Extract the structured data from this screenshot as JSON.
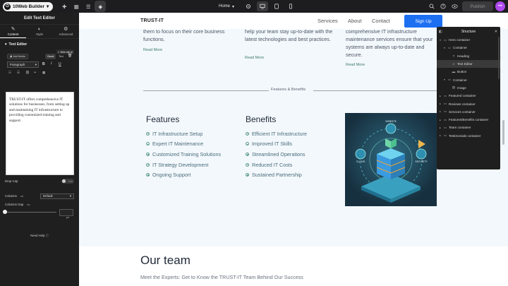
{
  "topbar": {
    "brand": "10Web Builder",
    "page_select": "Home",
    "publish": "Publish",
    "more": "•••"
  },
  "left_panel": {
    "title": "Edit Text Editor",
    "tabs": [
      {
        "label": "Content",
        "icon": "pencil-icon"
      },
      {
        "label": "Style",
        "icon": "half-circle-icon"
      },
      {
        "label": "Advanced",
        "icon": "gear-icon"
      }
    ],
    "section": "Text Editor",
    "add_media": "Add Media",
    "write_ai": "Write with AI",
    "mode_visual": "Visual",
    "mode_text": "Text",
    "paragraph": "Paragraph",
    "editor_text": "TRUST-IT offers comprehensive IT solutions for businesses, from setting up and maintaining IT infrastructure to providing customized training and support.",
    "drop_cap": "Drop Cap",
    "toggle_off": "OFF",
    "columns": "Columns",
    "columns_value": "Default",
    "columns_gap": "Columns Gap",
    "gap_unit": "px",
    "need_help": "Need Help"
  },
  "site": {
    "logo": "TRUST-IT",
    "nav": [
      "Services",
      "About",
      "Contact"
    ],
    "signup": "Sign Up",
    "columns_top": [
      {
        "text": "them to focus on their core business functions.",
        "read_more": "Read More"
      },
      {
        "text": "help your team stay up-to-date with the latest technologies and best practices.",
        "read_more": "Read More"
      },
      {
        "text": "comprehensive IT infrastructure maintenance services ensure that your systems are always up-to-date and secure.",
        "read_more": "Read More"
      }
    ],
    "divider_label": "Features & Benefits",
    "features_title": "Features",
    "features": [
      "IT Infrastructure Setup",
      "Expert IT Maintenance",
      "Customized Training Solutions",
      "IT Strategy Development",
      "Ongoing Support"
    ],
    "benefits_title": "Benefits",
    "benefits": [
      "Efficient IT Infrastructure",
      "Improved IT Skills",
      "Streamlined Operations",
      "Reduced IT Costs",
      "Sustained Partnership"
    ],
    "illustration_labels": [
      "WEBSITE",
      "CLOUD",
      "SECURITY"
    ],
    "team_title": "Our team",
    "team_subtitle": "Meet the Experts: Get to Know the TRUST-IT Team Behind Our Success"
  },
  "structure": {
    "title": "Structure",
    "rows": [
      {
        "label": "Hero container",
        "caret": "▾",
        "icon": "container-icon",
        "depth": 0,
        "selected": false
      },
      {
        "label": "Container",
        "caret": "▾",
        "icon": "container-icon",
        "depth": 1,
        "selected": false
      },
      {
        "label": "Heading",
        "caret": "",
        "icon": "heading-icon",
        "depth": 2,
        "selected": false
      },
      {
        "label": "Text Editor",
        "caret": "",
        "icon": "text-editor-icon",
        "depth": 2,
        "selected": true
      },
      {
        "label": "Button",
        "caret": "",
        "icon": "button-icon",
        "depth": 2,
        "selected": false
      },
      {
        "label": "Container",
        "caret": "▾",
        "icon": "container-icon",
        "depth": 1,
        "selected": false
      },
      {
        "label": "Image",
        "caret": "",
        "icon": "image-icon",
        "depth": 2,
        "selected": false
      },
      {
        "label": "Featured container",
        "caret": "▸",
        "icon": "container-icon",
        "depth": 0,
        "selected": false
      },
      {
        "label": "Reviews container",
        "caret": "▸",
        "icon": "container-icon",
        "depth": 0,
        "selected": false
      },
      {
        "label": "Services container",
        "caret": "▸",
        "icon": "container-icon",
        "depth": 0,
        "selected": false
      },
      {
        "label": "Features/Benefits container",
        "caret": "▸",
        "icon": "container-icon",
        "depth": 0,
        "selected": false
      },
      {
        "label": "Team container",
        "caret": "▸",
        "icon": "container-icon",
        "depth": 0,
        "selected": false
      },
      {
        "label": "Testimonials container",
        "caret": "▸",
        "icon": "container-icon",
        "depth": 0,
        "selected": false
      }
    ]
  },
  "colors": {
    "accent_blue": "#1d6ff2",
    "brand_purple": "#b049ef",
    "panel_dark": "#1f1f1f",
    "hero_bg": "#f3f8fc"
  }
}
